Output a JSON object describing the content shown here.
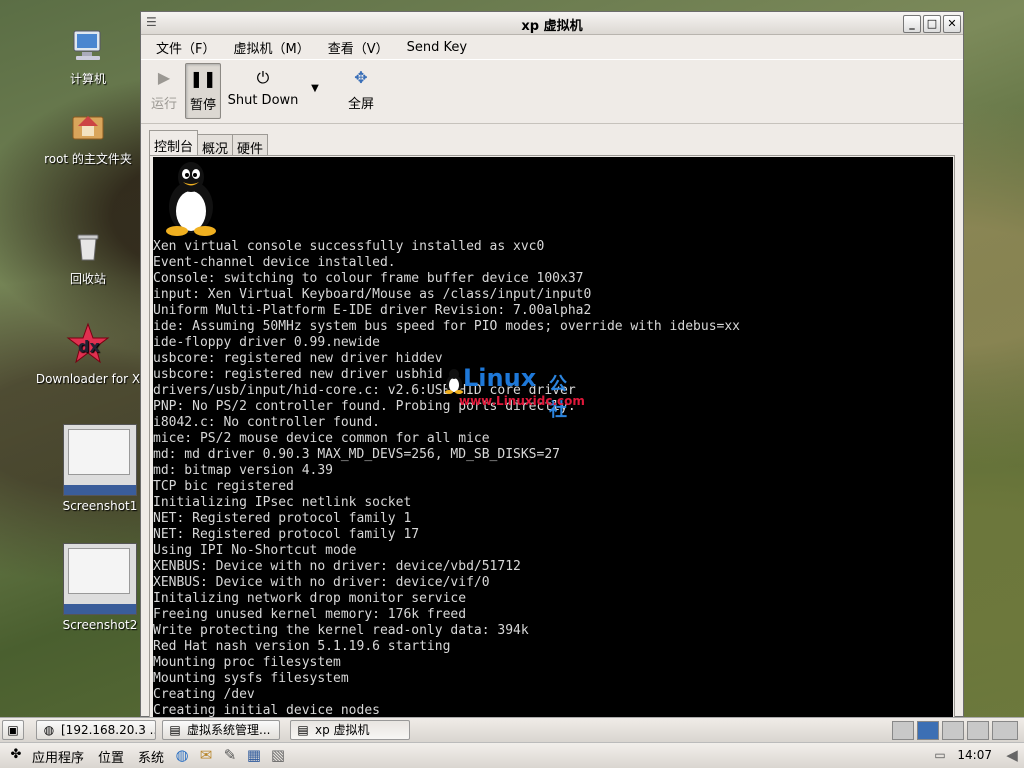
{
  "desktop": {
    "icons": [
      {
        "label": "计算机"
      },
      {
        "label": "root 的主文件夹"
      },
      {
        "label": "回收站"
      },
      {
        "label": "Downloader for X"
      },
      {
        "label": "Screenshot1"
      },
      {
        "label": "Screenshot2"
      }
    ]
  },
  "window": {
    "title": "xp 虚拟机",
    "menu": [
      "文件（F）",
      "虚拟机（M）",
      "查看（V）",
      "Send Key"
    ],
    "toolbar": {
      "run": "运行",
      "pause": "暂停",
      "shutdown": "Shut Down",
      "fullscreen": "全屏"
    },
    "tabs": [
      "控制台",
      "概况",
      "硬件"
    ],
    "console": {
      "lines": [
        "Xen virtual console successfully installed as xvc0",
        "Event-channel device installed.",
        "Console: switching to colour frame buffer device 100x37",
        "input: Xen Virtual Keyboard/Mouse as /class/input/input0",
        "Uniform Multi-Platform E-IDE driver Revision: 7.00alpha2",
        "ide: Assuming 50MHz system bus speed for PIO modes; override with idebus=xx",
        "ide-floppy driver 0.99.newide",
        "usbcore: registered new driver hiddev",
        "usbcore: registered new driver usbhid",
        "drivers/usb/input/hid-core.c: v2.6:USB HID core driver",
        "PNP: No PS/2 controller found. Probing ports directly.",
        "i8042.c: No controller found.",
        "mice: PS/2 mouse device common for all mice",
        "md: md driver 0.90.3 MAX_MD_DEVS=256, MD_SB_DISKS=27",
        "md: bitmap version 4.39",
        "TCP bic registered",
        "Initializing IPsec netlink socket",
        "NET: Registered protocol family 1",
        "NET: Registered protocol family 17",
        "Using IPI No-Shortcut mode",
        "XENBUS: Device with no driver: device/vbd/51712",
        "XENBUS: Device with no driver: device/vif/0",
        "Initalizing network drop monitor service",
        "Freeing unused kernel memory: 176k freed",
        "Write protecting the kernel read-only data: 394k",
        "Red Hat nash version 5.1.19.6 starting",
        "Mounting proc filesystem",
        "Mounting sysfs filesystem",
        "Creating /dev",
        "Creating initial device nodes"
      ]
    },
    "watermark": {
      "brand": "Linux",
      "suffix": "公社",
      "url": "www.Linuxidc.com"
    }
  },
  "taskbar": {
    "tasks": [
      {
        "label": "[192.168.20.3 ..."
      },
      {
        "label": "虚拟系统管理..."
      },
      {
        "label": "xp 虚拟机"
      }
    ]
  },
  "panel": {
    "menus": [
      "应用程序",
      "位置",
      "系统"
    ],
    "clock": "14:07"
  }
}
